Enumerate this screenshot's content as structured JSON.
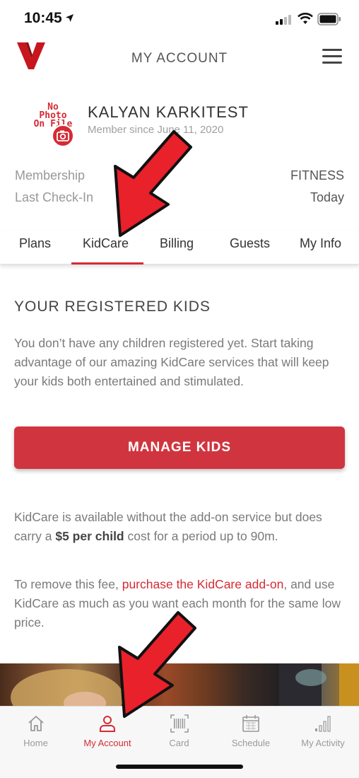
{
  "status_bar": {
    "time": "10:45"
  },
  "header": {
    "title": "MY ACCOUNT"
  },
  "profile": {
    "photo_placeholder": "No Photo On File",
    "name": "KALYAN KARKITEST",
    "member_since": "Member since June 11, 2020"
  },
  "membership": {
    "membership_label": "Membership",
    "membership_value": "FITNESS",
    "last_checkin_label": "Last Check-In",
    "last_checkin_value": "Today"
  },
  "tabs": [
    {
      "label": "Plans",
      "active": false
    },
    {
      "label": "KidCare",
      "active": true
    },
    {
      "label": "Billing",
      "active": false
    },
    {
      "label": "Guests",
      "active": false
    },
    {
      "label": "My Info",
      "active": false
    }
  ],
  "kids": {
    "section_title": "YOUR REGISTERED KIDS",
    "intro": "You don’t have any children registered yet. Start taking advantage of our amazing KidCare services that will keep your kids both entertained and stimulated.",
    "manage_button": "MANAGE KIDS",
    "fee_text_before": "KidCare is available without the add-on service but does carry a ",
    "fee_text_bold": "$5 per child",
    "fee_text_after": " cost for a period up to 90m.",
    "remove_text_before": "To remove this fee, ",
    "remove_link": "purchase the KidCare add-on",
    "remove_text_after": ", and use KidCare as much as you want each month for the same low price."
  },
  "bottom_nav": [
    {
      "label": "Home",
      "icon": "home-icon",
      "active": false
    },
    {
      "label": "My Account",
      "icon": "user-icon",
      "active": true
    },
    {
      "label": "Card",
      "icon": "barcode-icon",
      "active": false
    },
    {
      "label": "Schedule",
      "icon": "calendar-icon",
      "active": false
    },
    {
      "label": "My Activity",
      "icon": "activity-bars-icon",
      "active": false
    }
  ],
  "colors": {
    "brand_red": "#d52b35",
    "arrow_red": "#e8212a",
    "text_gray": "#7a7a7a"
  }
}
